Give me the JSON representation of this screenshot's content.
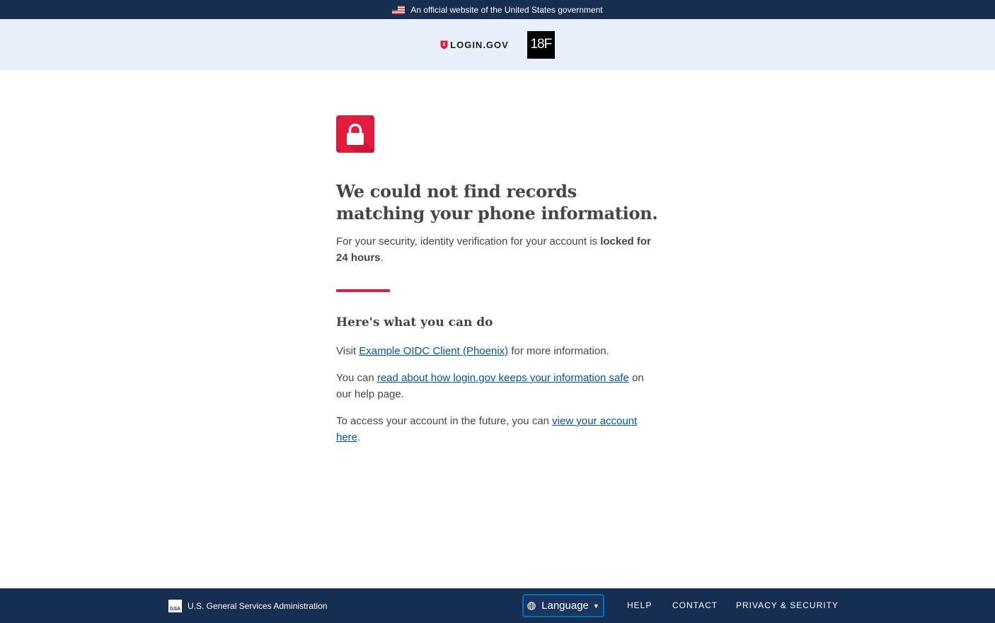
{
  "gov_banner": {
    "text": "An official website of the United States government"
  },
  "header": {
    "brand": "LOGIN.GOV",
    "partner_logo": "18F"
  },
  "main": {
    "icon": "lock-icon",
    "heading": "We could not find records matching your phone information.",
    "lead_prefix": "For your security, identity verification for your account is ",
    "lead_bold": "locked for 24 hours",
    "lead_suffix": ".",
    "subheading": "Here's what you can do",
    "visit_prefix": "Visit ",
    "visit_link": "Example OIDC Client (Phoenix)",
    "visit_suffix": " for more information.",
    "read_prefix": "You can ",
    "read_link": "read about how login.gov keeps your information safe",
    "read_suffix": " on our help page.",
    "access_prefix": "To access your account in the future, you can ",
    "access_link": "view your account here",
    "access_suffix": "."
  },
  "footer": {
    "gsa_logo": "GSA",
    "agency": "U.S. General Services Administration",
    "language_label": "Language",
    "links": [
      "HELP",
      "CONTACT",
      "PRIVACY & SECURITY"
    ]
  },
  "colors": {
    "navy": "#162e51",
    "accent_red": "#e21c3d",
    "link_blue": "#0055a4",
    "header_bg": "#e7f0fa"
  }
}
